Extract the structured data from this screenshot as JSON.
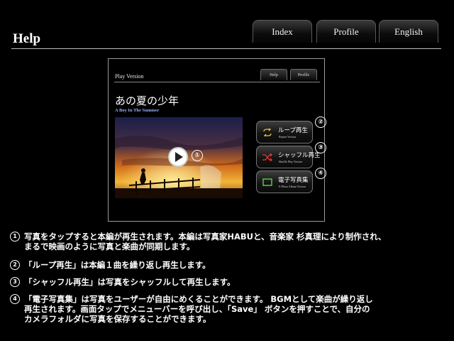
{
  "header": {
    "title": "Help",
    "tabs": [
      {
        "label": "Index"
      },
      {
        "label": "Profile"
      },
      {
        "label": "English"
      }
    ]
  },
  "preview": {
    "title": "Play Version",
    "tabs": [
      {
        "label": "Help"
      },
      {
        "label": "Profile"
      }
    ],
    "song_title_jp": "あの夏の少年",
    "song_title_en": "A Boy In The Summer",
    "modes": [
      {
        "label": "ループ再生",
        "sub": "Repeat Version",
        "marker": "②",
        "icon": "repeat-icon"
      },
      {
        "label": "シャッフル再生",
        "sub": "Shuffle Play Version",
        "marker": "③",
        "icon": "shuffle-icon"
      },
      {
        "label": "電子写真集",
        "sub": "E-Photo Album Version",
        "marker": "④",
        "icon": "photo-album-icon"
      }
    ],
    "play_marker": "①",
    "colors": {
      "accent": "#9ab0ff",
      "sky_top": "#1a1f4a",
      "sky_mid": "#d06a1a",
      "sky_low": "#f2b53a"
    }
  },
  "descriptions": [
    {
      "num": "1",
      "lines": [
        "写真をタップすると本編が再生されます。本編は写真家HABUと、音楽家 杉真理により制作され、",
        "まるで映画のように写真と楽曲が同期します。"
      ]
    },
    {
      "num": "2",
      "lines": [
        "「ループ再生」は本編１曲を繰り返し再生します。"
      ]
    },
    {
      "num": "3",
      "lines": [
        "「シャッフル再生」は写真をシャッフルして再生します。"
      ]
    },
    {
      "num": "4",
      "lines": [
        "「電子写真集」は写真をユーザーが自由にめくることができます。 BGMとして楽曲が繰り返し",
        "再生されます。画面タップでメニューバーを呼び出し、「Save」 ボタンを押すことで、自分の",
        "カメラフォルダに写真を保存することができます。"
      ]
    }
  ]
}
